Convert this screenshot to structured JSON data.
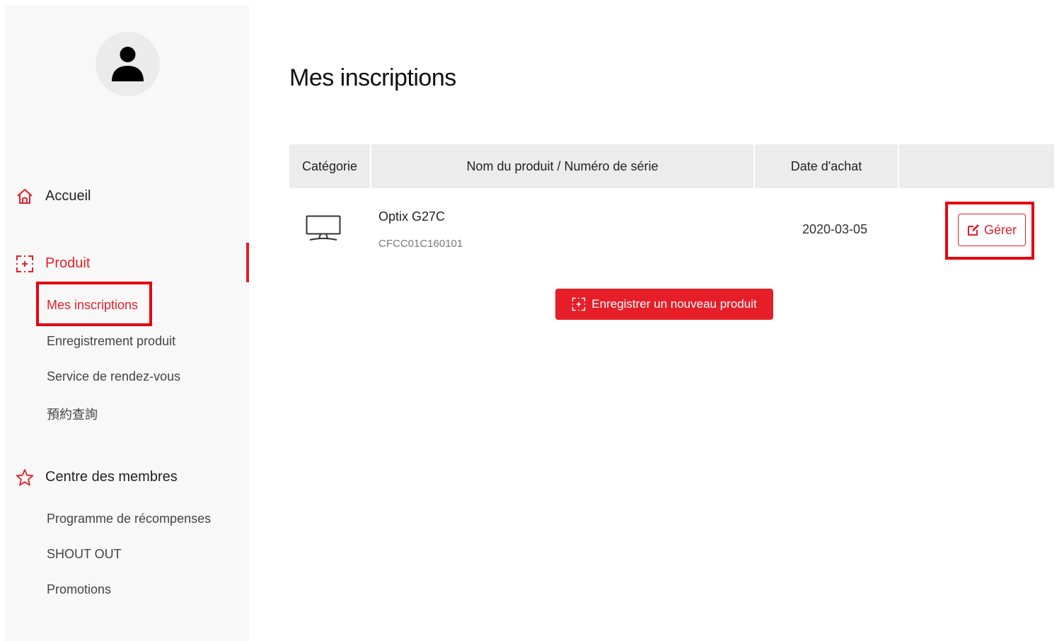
{
  "sidebar": {
    "sections": [
      {
        "label": "Accueil",
        "icon": "home-icon"
      },
      {
        "label": "Produit",
        "icon": "product-frame-icon"
      },
      {
        "label": "Centre des membres",
        "icon": "star-icon"
      }
    ],
    "product_items": [
      "Mes inscriptions",
      "Enregistrement produit",
      "Service de rendez-vous",
      "預約查詢"
    ],
    "member_items": [
      "Programme de récompenses",
      "SHOUT OUT",
      "Promotions"
    ]
  },
  "main": {
    "title": "Mes inscriptions",
    "table": {
      "headers": [
        "Catégorie",
        "Nom du produit / Numéro de série",
        "Date d'achat",
        ""
      ],
      "rows": [
        {
          "category_icon": "monitor-icon",
          "name": "Optix G27C",
          "serial": "CFCC01C160101",
          "date": "2020-03-05",
          "action_label": "Gérer"
        }
      ]
    },
    "register_button": "Enregistrer un nouveau produit"
  },
  "colors": {
    "accent": "#e61e28",
    "highlight": "#e60012",
    "sidebar_bg": "#f8f8f8",
    "header_bg": "#ececec"
  }
}
